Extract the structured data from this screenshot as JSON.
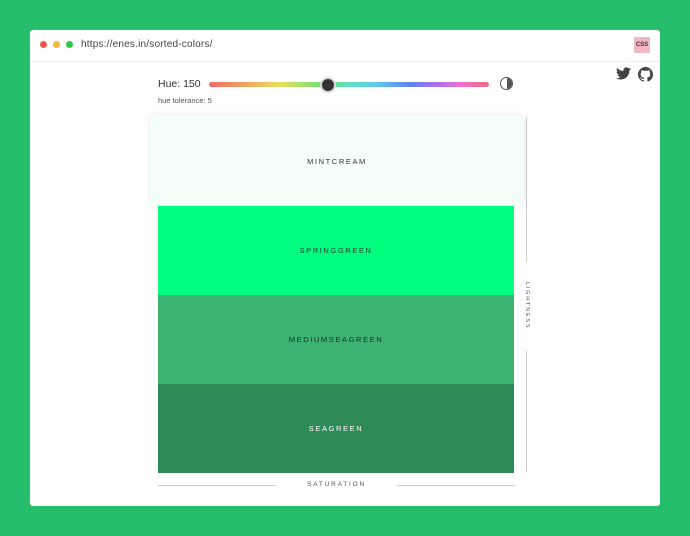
{
  "browser": {
    "url": "https://enes.in/sorted-colors/",
    "badge": "CSS"
  },
  "controls": {
    "hue_label": "Hue: 150",
    "hue_value": 150,
    "hue_max": 360,
    "tolerance_label": "hue tolerance: 5"
  },
  "colors": [
    {
      "name": "MINTCREAM",
      "hex": "#f5fffa"
    },
    {
      "name": "SPRINGGREEN",
      "hex": "#00ff7f"
    },
    {
      "name": "MEDIUMSEAGREEN",
      "hex": "#3cb371"
    },
    {
      "name": "SEAGREEN",
      "hex": "#2e8b57"
    }
  ],
  "axes": {
    "vertical": "LIGHTNESS",
    "horizontal": "SATURATION"
  },
  "icons": {
    "social": [
      "twitter-icon",
      "github-icon"
    ],
    "theme_toggle": "contrast-icon"
  },
  "theme": {
    "page_background": "#26bd6c",
    "window_background": "#ffffff"
  }
}
